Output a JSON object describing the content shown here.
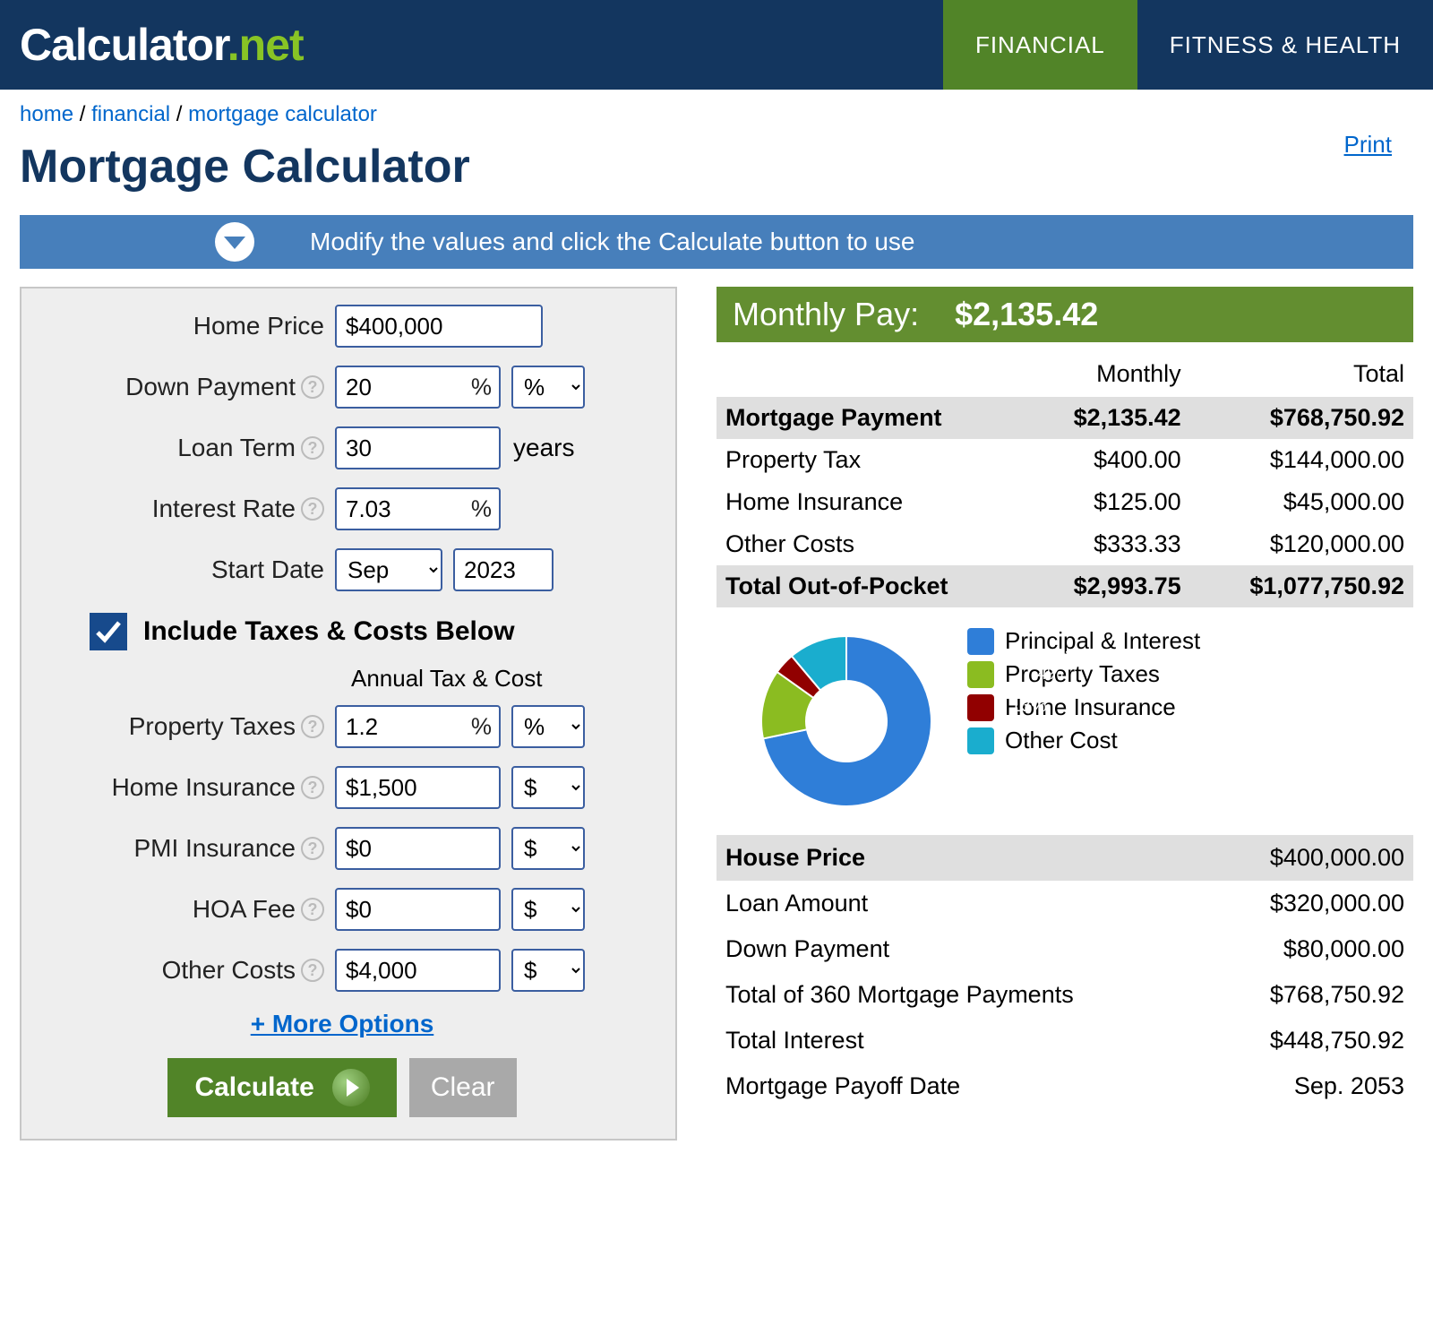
{
  "header": {
    "logo_main": "Calculator",
    "logo_dot": ".",
    "logo_net": "net",
    "nav": {
      "financial": "FINANCIAL",
      "fitness": "FITNESS & HEALTH"
    }
  },
  "breadcrumb": {
    "home": "home",
    "financial": "financial",
    "current": "mortgage calculator"
  },
  "print": "Print",
  "title": "Mortgage Calculator",
  "banner": "Modify the values and click the Calculate button to use",
  "form": {
    "home_price": {
      "label": "Home Price",
      "value": "$400,000"
    },
    "down_payment": {
      "label": "Down Payment",
      "value": "20",
      "unit": "%",
      "unit_select": "%"
    },
    "loan_term": {
      "label": "Loan Term",
      "value": "30",
      "suffix": "years"
    },
    "interest_rate": {
      "label": "Interest Rate",
      "value": "7.03",
      "unit": "%"
    },
    "start_date": {
      "label": "Start Date",
      "month": "Sep",
      "year": "2023"
    },
    "include_chk": "Include Taxes & Costs Below",
    "annual_head": "Annual Tax & Cost",
    "property_taxes": {
      "label": "Property Taxes",
      "value": "1.2",
      "unit": "%",
      "unit_select": "%"
    },
    "home_insurance": {
      "label": "Home Insurance",
      "value": "$1,500",
      "unit_select": "$"
    },
    "pmi": {
      "label": "PMI Insurance",
      "value": "$0",
      "unit_select": "$"
    },
    "hoa": {
      "label": "HOA Fee",
      "value": "$0",
      "unit_select": "$"
    },
    "other": {
      "label": "Other Costs",
      "value": "$4,000",
      "unit_select": "$"
    },
    "more": "+ More Options",
    "calculate": "Calculate",
    "clear": "Clear"
  },
  "results": {
    "pay_label": "Monthly Pay:",
    "pay_value": "$2,135.42",
    "hdr_monthly": "Monthly",
    "hdr_total": "Total",
    "rows": [
      {
        "label": "Mortgage Payment",
        "m": "$2,135.42",
        "t": "$768,750.92",
        "shade": true,
        "bold": true
      },
      {
        "label": "Property Tax",
        "m": "$400.00",
        "t": "$144,000.00"
      },
      {
        "label": "Home Insurance",
        "m": "$125.00",
        "t": "$45,000.00"
      },
      {
        "label": "Other Costs",
        "m": "$333.33",
        "t": "$120,000.00"
      },
      {
        "label": "Total Out-of-Pocket",
        "m": "$2,993.75",
        "t": "$1,077,750.92",
        "shade": true,
        "bold": true
      }
    ],
    "legend": [
      {
        "name": "Principal & Interest",
        "color": "#2f7ed8"
      },
      {
        "name": "Property Taxes",
        "color": "#8bbc21"
      },
      {
        "name": "Home Insurance",
        "color": "#910000"
      },
      {
        "name": "Other Cost",
        "color": "#1aadce"
      }
    ],
    "summary": [
      {
        "label": "House Price",
        "val": "$400,000.00",
        "shade": true
      },
      {
        "label": "Loan Amount",
        "val": "$320,000.00"
      },
      {
        "label": "Down Payment",
        "val": "$80,000.00"
      },
      {
        "label": "Total of 360 Mortgage Payments",
        "val": "$768,750.92"
      },
      {
        "label": "Total Interest",
        "val": "$448,750.92"
      },
      {
        "label": "Mortgage Payoff Date",
        "val": "Sep. 2053"
      }
    ]
  },
  "chart_data": {
    "type": "pie",
    "title": "",
    "series": [
      {
        "name": "Principal & Interest",
        "value": 71,
        "color": "#2f7ed8",
        "label": "71%"
      },
      {
        "name": "Property Taxes",
        "value": 13,
        "color": "#8bbc21",
        "label": "13%"
      },
      {
        "name": "Home Insurance",
        "value": 4,
        "color": "#910000",
        "label": "4%"
      },
      {
        "name": "Other Cost",
        "value": 11,
        "color": "#1aadce",
        "label": "11%"
      }
    ]
  }
}
